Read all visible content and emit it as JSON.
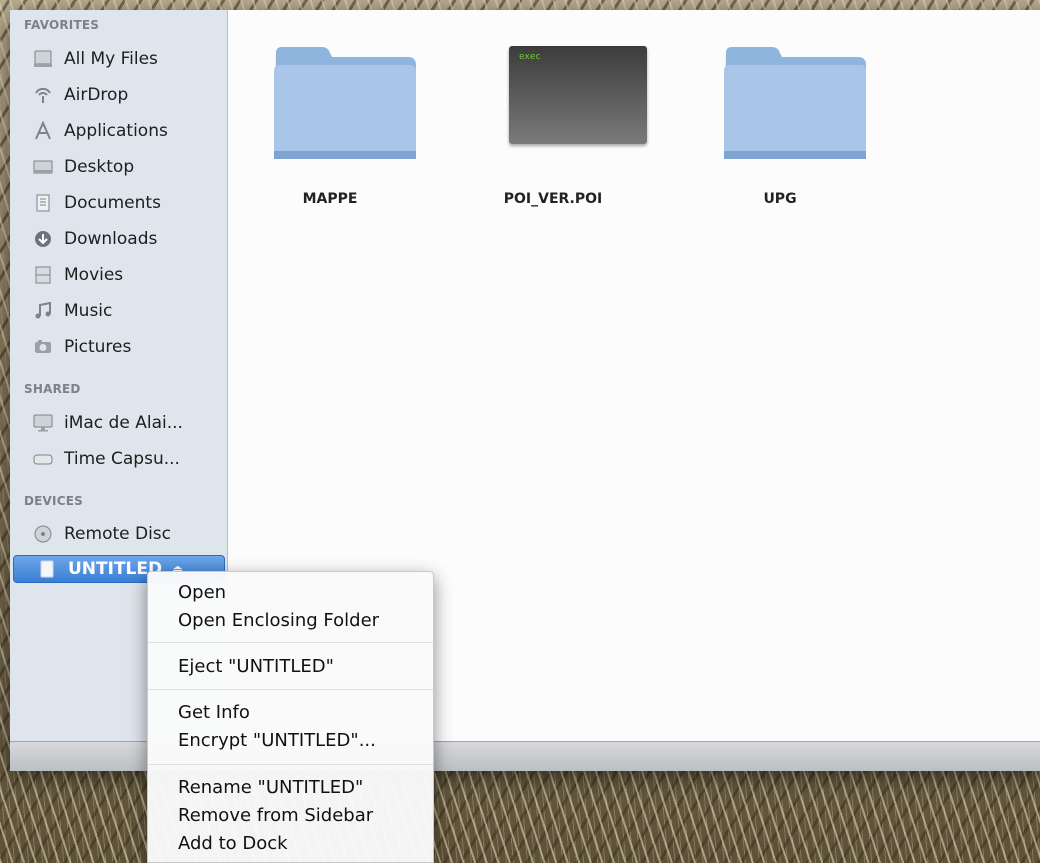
{
  "sidebar": {
    "favorites_header": "FAVORITES",
    "shared_header": "SHARED",
    "devices_header": "DEVICES",
    "favorites": [
      {
        "label": "All My Files",
        "icon": "all-files-icon"
      },
      {
        "label": "AirDrop",
        "icon": "airdrop-icon"
      },
      {
        "label": "Applications",
        "icon": "applications-icon"
      },
      {
        "label": "Desktop",
        "icon": "desktop-icon"
      },
      {
        "label": "Documents",
        "icon": "documents-icon"
      },
      {
        "label": "Downloads",
        "icon": "downloads-icon"
      },
      {
        "label": "Movies",
        "icon": "movies-icon"
      },
      {
        "label": "Music",
        "icon": "music-icon"
      },
      {
        "label": "Pictures",
        "icon": "pictures-icon"
      }
    ],
    "shared": [
      {
        "label": "iMac de Alai...",
        "icon": "imac-icon"
      },
      {
        "label": "Time Capsu...",
        "icon": "time-capsule-icon"
      }
    ],
    "devices": [
      {
        "label": "Remote Disc",
        "icon": "remote-disc-icon"
      },
      {
        "label": "UNTITLED",
        "icon": "external-drive-icon",
        "selected": true,
        "eject_glyph": "⏏"
      }
    ]
  },
  "files": [
    {
      "name": "MAPPE",
      "type": "folder"
    },
    {
      "name": "POI_VER.POI",
      "type": "executable",
      "badge": "exec"
    },
    {
      "name": "UPG",
      "type": "folder"
    }
  ],
  "context_menu": {
    "items": [
      "Open",
      "Open Enclosing Folder",
      "Eject \"UNTITLED\"",
      "Get Info",
      "Encrypt \"UNTITLED\"...",
      "Rename \"UNTITLED\"",
      "Remove from Sidebar",
      "Add to Dock"
    ]
  },
  "colors": {
    "sidebar_bg": "#dfe5ec",
    "selection": "#3a7fd6",
    "folder": "#8fb4dd"
  }
}
